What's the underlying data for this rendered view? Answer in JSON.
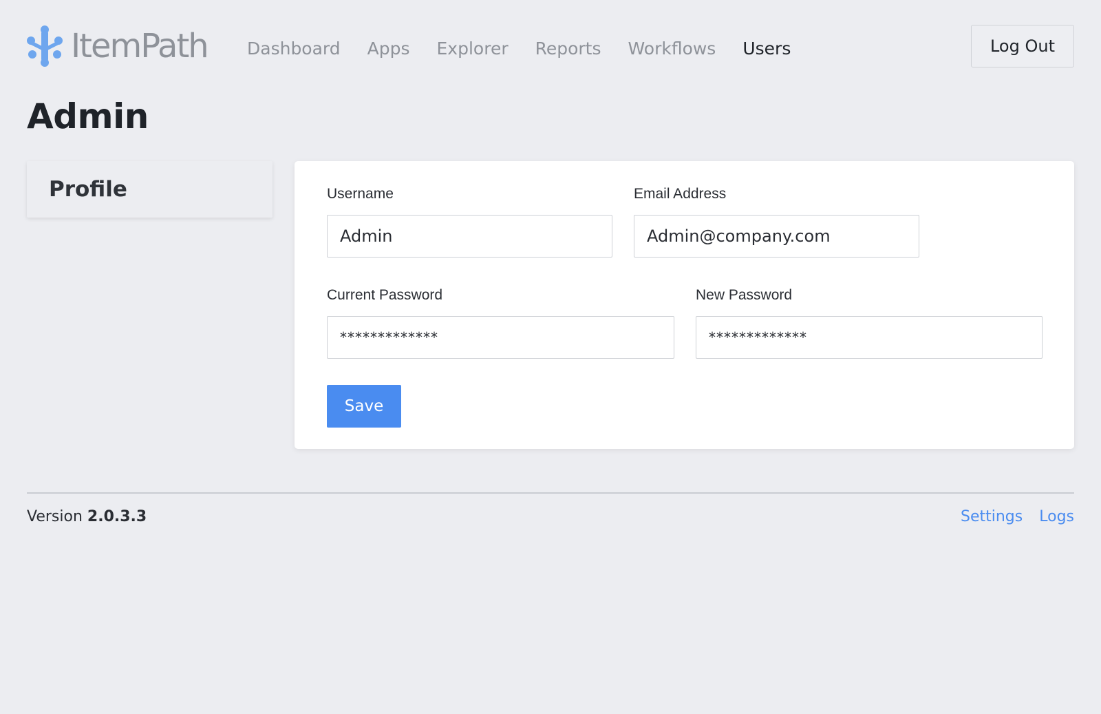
{
  "app": {
    "logo_text": "ItemPath",
    "logo_icon": "itempath-logo-icon",
    "brand_color": "#6ea6ee"
  },
  "nav": {
    "items": [
      {
        "label": "Dashboard"
      },
      {
        "label": "Apps"
      },
      {
        "label": "Explorer"
      },
      {
        "label": "Reports"
      },
      {
        "label": "Workflows"
      },
      {
        "label": "Users",
        "active": true
      }
    ]
  },
  "header": {
    "logout_label": "Log Out"
  },
  "page": {
    "title": "Admin"
  },
  "sidebar": {
    "items": [
      {
        "label": "Profile"
      }
    ]
  },
  "form": {
    "username_label": "Username",
    "username_value": "Admin",
    "email_label": "Email Address",
    "email_value": "Admin@company.com",
    "current_password_label": "Current Password",
    "current_password_value": "*************",
    "new_password_label": "New Password",
    "new_password_value": "*************",
    "save_label": "Save"
  },
  "footer": {
    "version_prefix": "Version",
    "version_number": "2.0.3.3",
    "links": [
      {
        "label": "Settings"
      },
      {
        "label": "Logs"
      }
    ],
    "link_color": "#4a8cf0"
  }
}
